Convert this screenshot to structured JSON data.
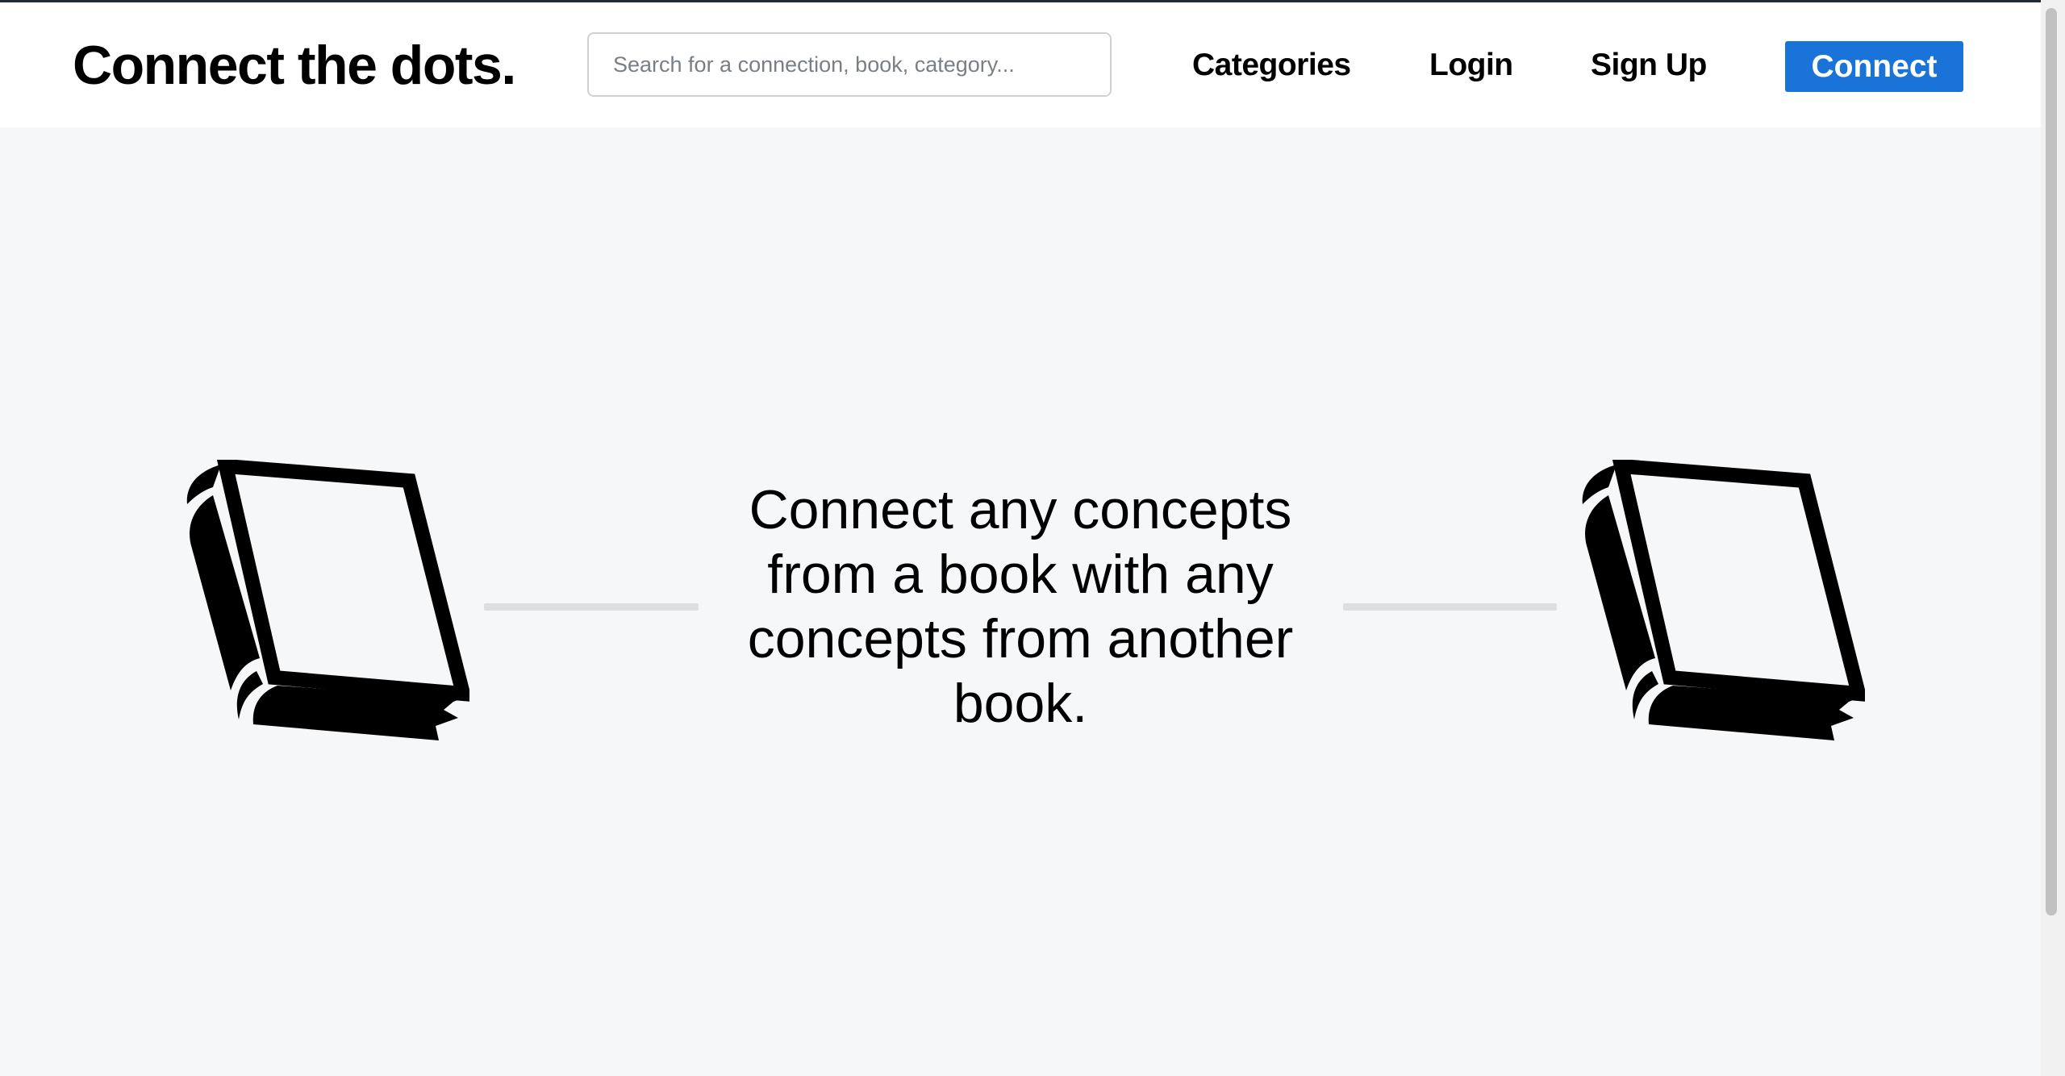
{
  "header": {
    "logo": "Connect the dots.",
    "search_placeholder": "Search for a connection, book, category...",
    "nav": {
      "categories": "Categories",
      "login": "Login",
      "signup": "Sign Up"
    },
    "connect_button": "Connect"
  },
  "hero": {
    "tagline": "Connect any concepts from a book with any concepts from another book.",
    "left_icon": "book-icon",
    "right_icon": "book-icon"
  },
  "colors": {
    "accent": "#1a73d9",
    "background": "#f6f7f9",
    "header_background": "#ffffff",
    "connector": "#dcdee2"
  }
}
